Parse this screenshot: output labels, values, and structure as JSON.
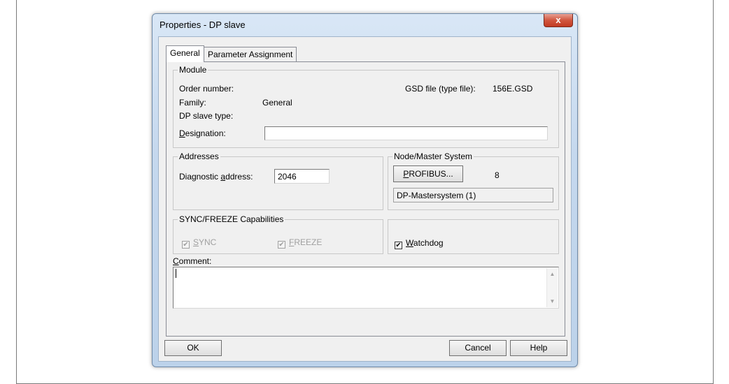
{
  "window": {
    "title": "Properties - DP slave",
    "close_label": "x"
  },
  "tabs": [
    {
      "label": "General",
      "active": true
    },
    {
      "label": "Parameter Assignment",
      "active": false
    }
  ],
  "module": {
    "legend": "Module",
    "order_number_label": "Order number:",
    "family_label": "Family:",
    "family_value": "General",
    "dp_slave_type_label": "DP slave type:",
    "designation_label_first": "D",
    "designation_label_rest": "esignation:",
    "designation_value": "",
    "gsd_label": "GSD file (type file):",
    "gsd_value": "156E.GSD"
  },
  "addresses": {
    "legend": "Addresses",
    "diagnostic_label_pre": "Diagnostic ",
    "diagnostic_label_u": "a",
    "diagnostic_label_post": "ddress:",
    "diagnostic_value": "2046"
  },
  "node_master": {
    "legend": "Node/Master System",
    "button_u": "P",
    "button_rest": "ROFIBUS...",
    "node_number": "8",
    "master_system": "DP-Mastersystem (1)"
  },
  "sync_freeze": {
    "legend": "SYNC/FREEZE Capabilities",
    "sync_u": "S",
    "sync_rest": "YNC",
    "freeze_u": "F",
    "freeze_rest": "REEZE",
    "sync_checked": true,
    "freeze_checked": true
  },
  "watchdog": {
    "u": "W",
    "rest": "atchdog",
    "checked": true
  },
  "comment": {
    "label_u": "C",
    "label_rest": "omment:",
    "value": ""
  },
  "buttons": {
    "ok": "OK",
    "cancel": "Cancel",
    "help": "Help"
  },
  "check_mark": "✔",
  "scroll_up": "▲",
  "scroll_down": "▼"
}
